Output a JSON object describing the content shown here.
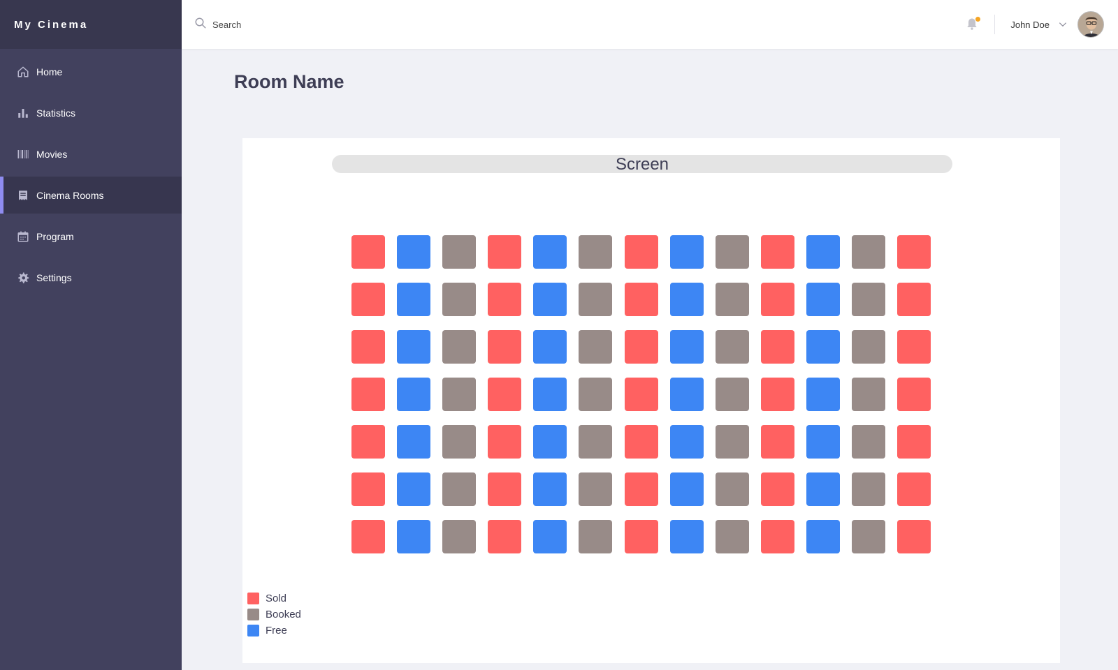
{
  "brand": "My Cinema",
  "nav": [
    {
      "label": "Home",
      "icon": "home-icon",
      "active": false
    },
    {
      "label": "Statistics",
      "icon": "bar-chart-icon",
      "active": false
    },
    {
      "label": "Movies",
      "icon": "barcode-icon",
      "active": false
    },
    {
      "label": "Cinema Rooms",
      "icon": "receipt-icon",
      "active": true
    },
    {
      "label": "Program",
      "icon": "calendar-icon",
      "active": false
    },
    {
      "label": "Settings",
      "icon": "gear-icon",
      "active": false
    }
  ],
  "search": {
    "placeholder": "Search",
    "value": ""
  },
  "user": {
    "name": "John Doe",
    "has_notification": true
  },
  "page": {
    "title": "Room Name"
  },
  "screen_label": "Screen",
  "colors": {
    "sold": "#ff6161",
    "booked": "#988b88",
    "free": "#3d86f4",
    "accent": "#8f8cf0",
    "sidebar": "#42415e",
    "notification": "#f5a524"
  },
  "seat_rows": [
    [
      "sold",
      "free",
      "booked",
      "sold",
      "free",
      "booked",
      "sold",
      "free",
      "booked",
      "sold",
      "free",
      "booked",
      "sold"
    ],
    [
      "sold",
      "free",
      "booked",
      "sold",
      "free",
      "booked",
      "sold",
      "free",
      "booked",
      "sold",
      "free",
      "booked",
      "sold"
    ],
    [
      "sold",
      "free",
      "booked",
      "sold",
      "free",
      "booked",
      "sold",
      "free",
      "booked",
      "sold",
      "free",
      "booked",
      "sold"
    ],
    [
      "sold",
      "free",
      "booked",
      "sold",
      "free",
      "booked",
      "sold",
      "free",
      "booked",
      "sold",
      "free",
      "booked",
      "sold"
    ],
    [
      "sold",
      "free",
      "booked",
      "sold",
      "free",
      "booked",
      "sold",
      "free",
      "booked",
      "sold",
      "free",
      "booked",
      "sold"
    ],
    [
      "sold",
      "free",
      "booked",
      "sold",
      "free",
      "booked",
      "sold",
      "free",
      "booked",
      "sold",
      "free",
      "booked",
      "sold"
    ],
    [
      "sold",
      "free",
      "booked",
      "sold",
      "free",
      "booked",
      "sold",
      "free",
      "booked",
      "sold",
      "free",
      "booked",
      "sold"
    ]
  ],
  "legend": [
    {
      "label": "Sold",
      "status": "sold"
    },
    {
      "label": "Booked",
      "status": "booked"
    },
    {
      "label": "Free",
      "status": "free"
    }
  ]
}
